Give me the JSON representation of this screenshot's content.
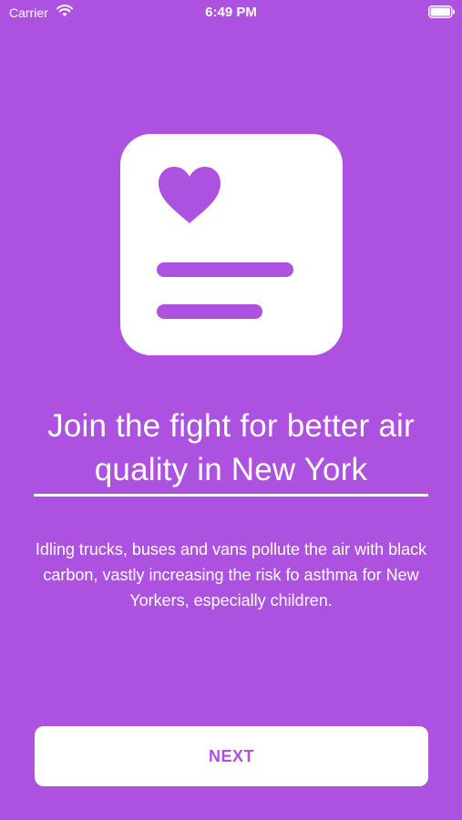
{
  "status_bar": {
    "carrier": "Carrier",
    "time": "6:49 PM",
    "wifi_icon": "wifi-icon",
    "battery_icon": "battery-full-icon"
  },
  "hero": {
    "icon": "health-card-icon",
    "heart_icon": "heart-icon"
  },
  "headline": "Join the fight for better air quality in New York",
  "body": "Idling trucks, buses and vans pollute the air with black carbon, vastly increasing the risk fo asthma for New Yorkers, especially children.",
  "next_button": {
    "label": "NEXT"
  },
  "colors": {
    "background": "#AD52E0",
    "foreground": "#FFFFFF",
    "accent": "#AD52E0"
  }
}
